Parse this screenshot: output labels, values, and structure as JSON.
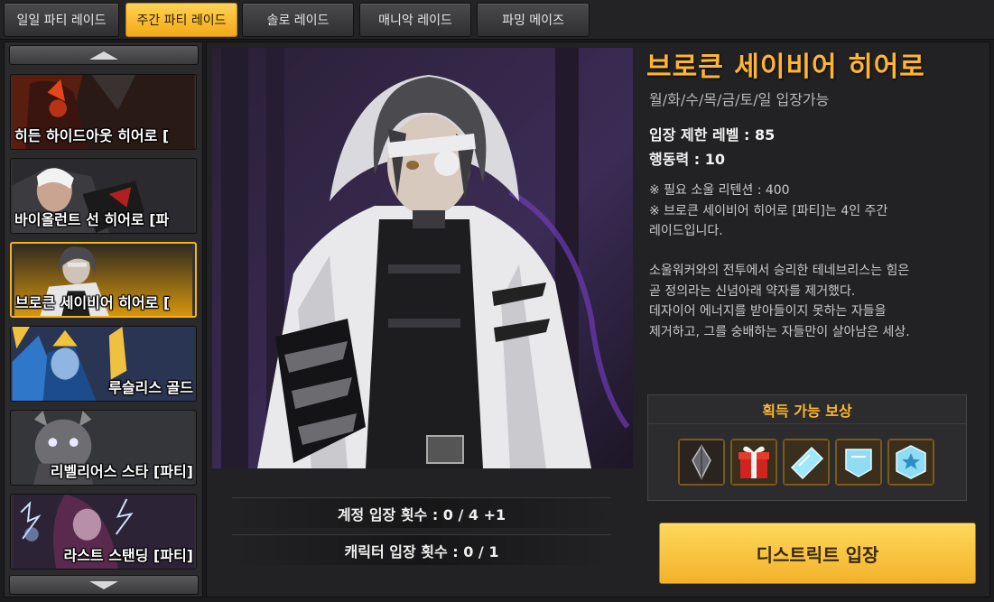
{
  "tabs": [
    {
      "label": "일일 파티 레이드",
      "active": false
    },
    {
      "label": "주간 파티 레이드",
      "active": true
    },
    {
      "label": "솔로 레이드",
      "active": false
    },
    {
      "label": "매니악 레이드",
      "active": false
    },
    {
      "label": "파밍 메이즈",
      "active": false
    }
  ],
  "raid_list": [
    {
      "name": "히든 하이드아웃 히어로 [",
      "selected": false
    },
    {
      "name": "바이올런트 선 히어로 [파",
      "selected": false
    },
    {
      "name": "브로큰 세이비어 히어로 [",
      "selected": true
    },
    {
      "name": "루슬리스 골드",
      "selected": false
    },
    {
      "name": "리벨리어스 스타 [파티]",
      "selected": false
    },
    {
      "name": "라스트 스탠딩 [파티]",
      "selected": false
    }
  ],
  "detail": {
    "title": "브로큰 세이비어 히어로",
    "days": "월/화/수/목/금/토/일 입장가능",
    "level_limit": "입장 제한 레벨 : 85",
    "action_power": "행동력 : 10",
    "notes": [
      "※ 필요 소울 리텐션 : 400",
      "※ 브로큰 세이비어 히어로 [파티]는 4인 주간",
      "레이드입니다."
    ],
    "story": [
      "소울워커와의 전투에서 승리한 테네브리스는 힘은",
      "곧 정의라는 신념아래 약자를 제거했다.",
      "데자이어 에너지를 받아들이지 못하는 자들을",
      "제거하고, 그를 숭배하는 자들만이 살아남은 세상."
    ],
    "account_entries": "계정 입장 횟수 : 0 / 4 +1",
    "character_entries": "캐릭터 입장 횟수 : 0 / 1"
  },
  "rewards": {
    "title": "획득 가능 보상",
    "items": [
      "dark-crystal-icon",
      "gift-box-icon",
      "ticket-icon",
      "ticket-icon",
      "star-ticket-icon"
    ]
  },
  "enter_button": "디스트릭트 입장",
  "colors": {
    "accent": "#ffb62e",
    "active_tab": "#f5b21d",
    "panel": "#222224"
  }
}
